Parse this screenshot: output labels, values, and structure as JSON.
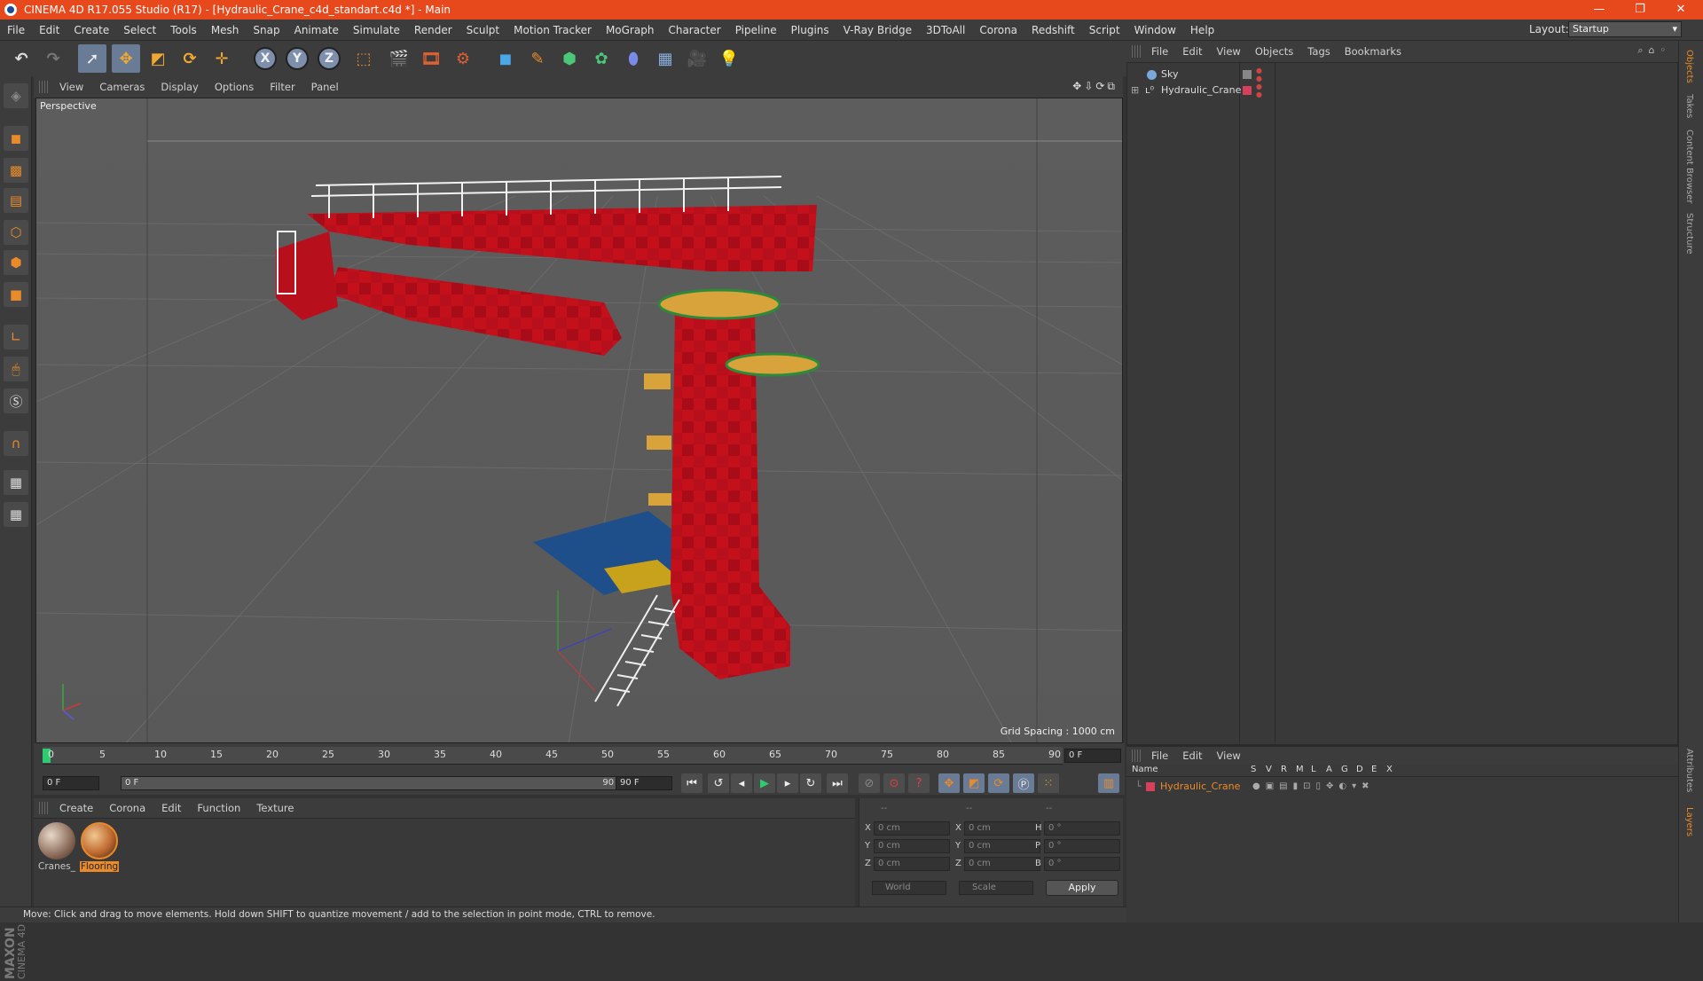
{
  "titlebar": {
    "title": "CINEMA 4D R17.055 Studio (R17) - [Hydraulic_Crane_c4d_standart.c4d *] - Main",
    "min": "—",
    "max": "❐",
    "close": "✕"
  },
  "menu": [
    "File",
    "Edit",
    "Create",
    "Select",
    "Tools",
    "Mesh",
    "Snap",
    "Animate",
    "Simulate",
    "Render",
    "Sculpt",
    "Motion Tracker",
    "MoGraph",
    "Character",
    "Pipeline",
    "Plugins",
    "V-Ray Bridge",
    "3DToAll",
    "Corona",
    "Redshift",
    "Script",
    "Window",
    "Help"
  ],
  "layout": {
    "label": "Layout:",
    "value": "Startup"
  },
  "toolbar": {
    "x_label": "X",
    "y_label": "Y",
    "z_label": "Z"
  },
  "viewport": {
    "menu": [
      "View",
      "Cameras",
      "Display",
      "Options",
      "Filter",
      "Panel"
    ],
    "label": "Perspective",
    "grid_spacing": "Grid Spacing : 1000 cm",
    "nav_icons": "✥⇩⟳⧉"
  },
  "timeline": {
    "ticks": [
      "0",
      "5",
      "10",
      "15",
      "20",
      "25",
      "30",
      "35",
      "40",
      "45",
      "50",
      "55",
      "60",
      "65",
      "70",
      "75",
      "80",
      "85",
      "90"
    ],
    "current_frame_right": "0 F",
    "start_field": "0 F",
    "range_start": "0 F",
    "range_end": "90 F",
    "end_field": "90 F"
  },
  "material_manager": {
    "menu": [
      "Create",
      "Corona",
      "Edit",
      "Function",
      "Texture"
    ],
    "materials": [
      {
        "name": "Cranes_",
        "selected": false
      },
      {
        "name": "Flooring",
        "selected": true
      }
    ]
  },
  "coordinates": {
    "headers": [
      "--",
      "--",
      "--"
    ],
    "rows": [
      {
        "a": "X",
        "av": "0 cm",
        "b": "X",
        "bv": "0 cm",
        "c": "H",
        "cv": "0 °"
      },
      {
        "a": "Y",
        "av": "0 cm",
        "b": "Y",
        "bv": "0 cm",
        "c": "P",
        "cv": "0 °"
      },
      {
        "a": "Z",
        "av": "0 cm",
        "b": "Z",
        "bv": "0 cm",
        "c": "B",
        "cv": "0 °"
      }
    ],
    "world": "World",
    "scale": "Scale",
    "apply": "Apply"
  },
  "status": "Move: Click and drag to move elements. Hold down SHIFT to quantize movement / add to the selection in point mode, CTRL to remove.",
  "objects_panel": {
    "menu": [
      "File",
      "Edit",
      "View",
      "Objects",
      "Tags",
      "Bookmarks"
    ],
    "items": [
      {
        "name": "Sky",
        "color": "#7aa8d8"
      },
      {
        "name": "Hydraulic_Crane",
        "color": "#d6405a"
      }
    ]
  },
  "layers_panel": {
    "menu": [
      "File",
      "Edit",
      "View"
    ],
    "columns": [
      "Name",
      "S",
      "V",
      "R",
      "M",
      "L",
      "A",
      "G",
      "D",
      "E",
      "X"
    ],
    "layers": [
      {
        "name": "Hydraulic_Crane",
        "color": "#d6405a"
      }
    ]
  },
  "side_tabs": [
    "Objects",
    "Takes",
    "Content Browser",
    "Structure",
    "Attributes",
    "Layers"
  ],
  "maxon": {
    "brand": "MAXON",
    "product": "CINEMA 4D"
  },
  "colors": {
    "accent": "#e8491c",
    "crane_red": "#c8101c",
    "selection": "#e98b2a"
  }
}
